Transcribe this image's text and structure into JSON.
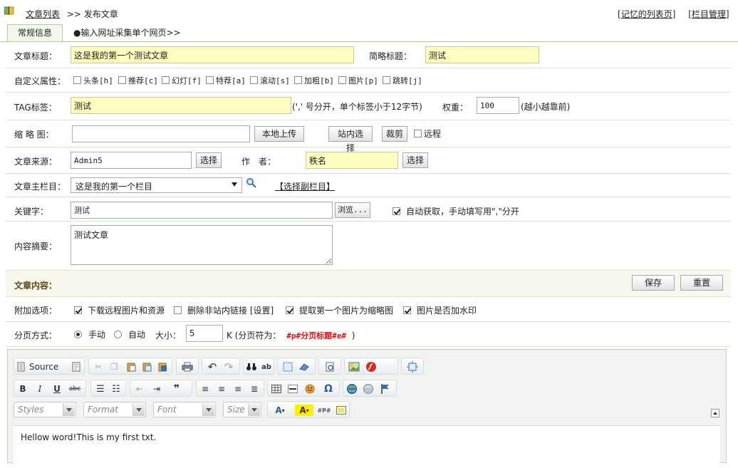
{
  "breadcrumb": {
    "link": "文章列表",
    "sep": ">>",
    "current": "发布文章"
  },
  "top_links": {
    "remembered": "记忆的列表页",
    "column": "栏目管理",
    "lb": "[",
    "rb": "]"
  },
  "tabs": {
    "general": "常规信息",
    "collect": "●输入网址采集单个网页>>"
  },
  "title_row": {
    "label": "文章标题：",
    "value": "这是我的第一个测试文章",
    "short_label": "简略标题：",
    "short_value": "测试"
  },
  "attrs": {
    "label": "自定义属性：",
    "items": [
      "头条[h]",
      "推荐[c]",
      "幻灯[f]",
      "特荐[a]",
      "滚动[s]",
      "加粗[b]",
      "图片[p]",
      "跳转[j]"
    ]
  },
  "tag_row": {
    "label": "TAG标签：",
    "value": "测试",
    "hint": "(',' 号分开，单个标签小于12字节)",
    "weight_label": "权重：",
    "weight_value": "100",
    "weight_hint": "(越小越靠前)"
  },
  "thumb_row": {
    "label": "缩 略 图：",
    "upload": "本地上传",
    "site_select": "站内选择",
    "crop": "裁剪",
    "remote": "远程"
  },
  "source_row": {
    "label": "文章来源：",
    "value": "Admin5",
    "select": "选择",
    "author_label": "作　者：",
    "author_value": "秩名",
    "author_select": "选择"
  },
  "column_row": {
    "label": "文章主栏目：",
    "value": "这是我的第一个栏目",
    "sub": "【选择副栏目】"
  },
  "keyword_row": {
    "label": "关键字：",
    "value": "测试",
    "browse": "浏览...",
    "auto": "自动获取，手动填写用\",\"分开"
  },
  "summary_row": {
    "label": "内容摘要：",
    "value": "测试文章"
  },
  "content_bar": {
    "label": "文章内容：",
    "save": "保存",
    "reset": "重置"
  },
  "extra_row": {
    "label": "附加选项：",
    "opt1": "下载远程图片和资源",
    "opt2": "删除非站内链接",
    "opt2_link": "[设置]",
    "opt3": "提取第一个图片为缩略图",
    "opt4": "图片是否加水印"
  },
  "paging_row": {
    "label": "分页方式：",
    "manual": "手动",
    "auto": "自动",
    "size_label": "大小：",
    "size_value": "5",
    "unit": "K (分页符为：",
    "symbol": "#p#分页标题#e#",
    "close": ")"
  },
  "editor": {
    "source": "Source",
    "styles": "Styles",
    "format": "Format",
    "font": "Font",
    "size": "Size",
    "content": "Hellow word!This is my first txt."
  },
  "colors": {
    "accent": "#b7c7a7",
    "yellow": "#ffffc0",
    "red": "#dd1111"
  }
}
